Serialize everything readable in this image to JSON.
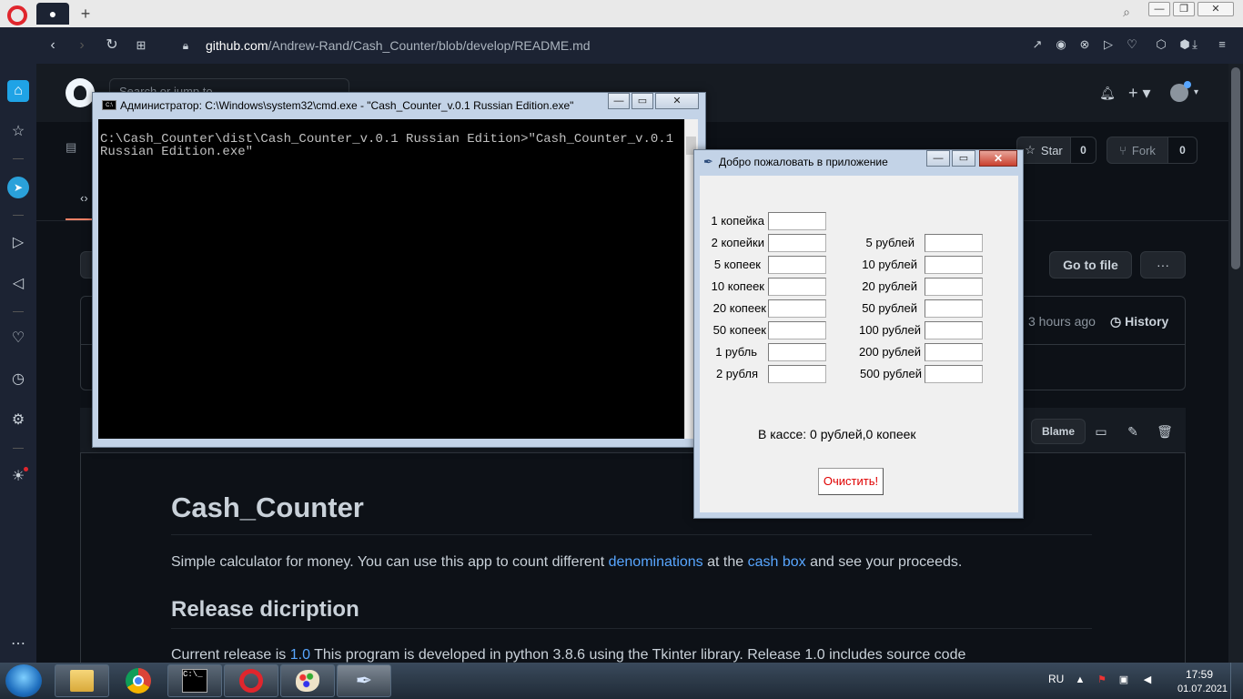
{
  "browser": {
    "tab_icon": "github-icon",
    "new_tab_label": "+",
    "address_host": "github.com",
    "address_path": "/Andrew-Rand/Cash_Counter/blob/develop/README.md",
    "window_controls": [
      "—",
      "❐",
      "✕"
    ]
  },
  "github": {
    "search_placeholder": "Search or jump to...",
    "star_label": "Star",
    "star_count": "0",
    "fork_label": "Fork",
    "fork_count": "0",
    "goto_file_label": "Go to file",
    "more_label": "···",
    "commit_time": "3 hours ago",
    "history_label": "History",
    "blame_label": "Blame",
    "readme": {
      "title": "Cash_Counter",
      "intro_before": "Simple calculator for money. You can use this app to count different ",
      "intro_link1": "denominations",
      "intro_mid": " at the ",
      "intro_link2": "cash box",
      "intro_after": " and see your proceeds.",
      "section_title": "Release dicription",
      "release_before": "Current release is ",
      "release_link": "1.0",
      "release_after": " This program is developed in python 3.8.6 using the Tkinter library. Release 1.0 includes source code"
    }
  },
  "cmd": {
    "title": "Администратор: C:\\Windows\\system32\\cmd.exe - \"Cash_Counter_v.0.1 Russian Edition.exe\"",
    "output": "C:\\Cash_Counter\\dist\\Cash_Counter_v.0.1 Russian Edition>\"Cash_Counter_v.0.1 Russian Edition.exe\""
  },
  "app": {
    "title": "Добро пожаловать в приложение",
    "coins": [
      "1 копейка",
      "2 копейки",
      "5 копеек",
      "10 копеек",
      "20 копеек",
      "50 копеек",
      "1 рубль",
      "2 рубля"
    ],
    "notes": [
      "5 рублей",
      "10 рублей",
      "20 рублей",
      "50 рублей",
      "100 рублей",
      "200 рублей",
      "500 рублей"
    ],
    "total": "В кассе: 0 рублей,0 копеек",
    "clear_label": "Очистить!",
    "colors": {
      "clear_text": "#e00000"
    }
  },
  "taskbar": {
    "apps": [
      "file-explorer",
      "chrome",
      "cmd",
      "opera",
      "paint",
      "tkinter-app"
    ],
    "language": "RU",
    "time": "17:59",
    "date": "01.07.2021"
  },
  "colors": {
    "github_bg": "#0d1117",
    "link": "#58a6ff",
    "opera_red": "#e0262d"
  }
}
